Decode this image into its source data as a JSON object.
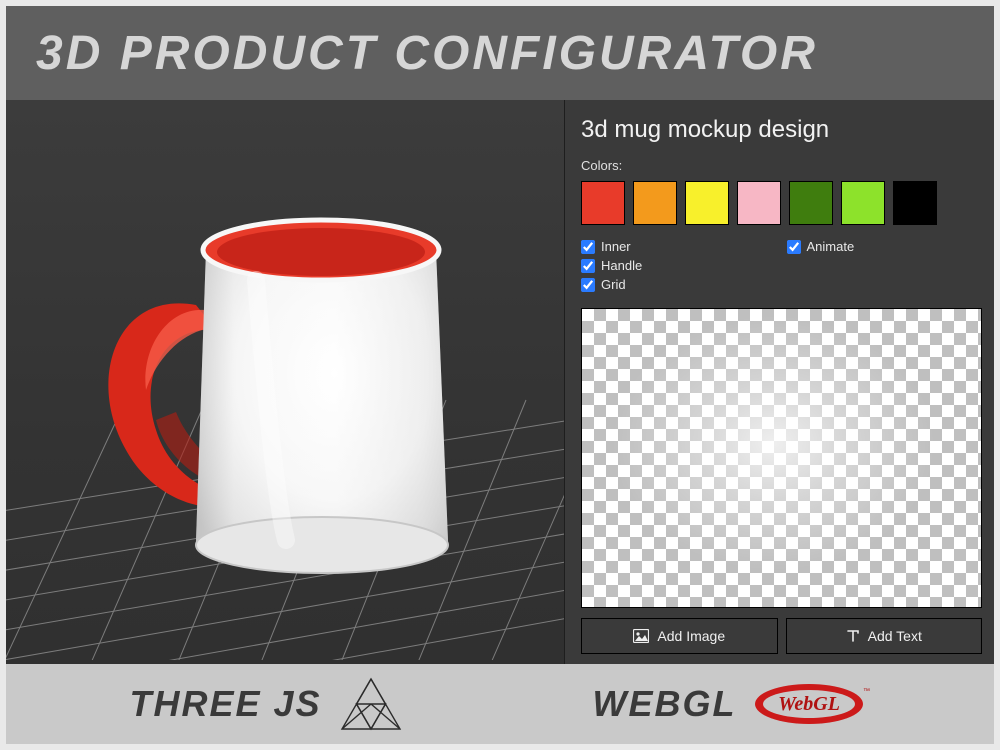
{
  "banner": {
    "title": "3D PRODUCT CONFIGURATOR"
  },
  "panel": {
    "title": "3d mug mockup design",
    "colors_label": "Colors:",
    "swatches": [
      {
        "name": "red",
        "hex": "#e83b2a"
      },
      {
        "name": "orange",
        "hex": "#f39a1c"
      },
      {
        "name": "yellow",
        "hex": "#f8f02b"
      },
      {
        "name": "pink",
        "hex": "#f7b7c5"
      },
      {
        "name": "darkgreen",
        "hex": "#3f7d0e"
      },
      {
        "name": "lime",
        "hex": "#8de22b"
      },
      {
        "name": "black",
        "hex": "#000000"
      }
    ],
    "checks": {
      "inner": {
        "label": "Inner",
        "checked": true
      },
      "handle": {
        "label": "Handle",
        "checked": true
      },
      "grid": {
        "label": "Grid",
        "checked": true
      },
      "animate": {
        "label": "Animate",
        "checked": true
      }
    },
    "buttons": {
      "add_image": "Add Image",
      "add_text": "Add Text"
    }
  },
  "footer": {
    "threejs_label": "THREE JS",
    "webgl_label": "WEBGL",
    "webgl_badge_text": "WebGL"
  },
  "product": {
    "accent_color": "#e83b2a",
    "body_color": "#ffffff"
  }
}
